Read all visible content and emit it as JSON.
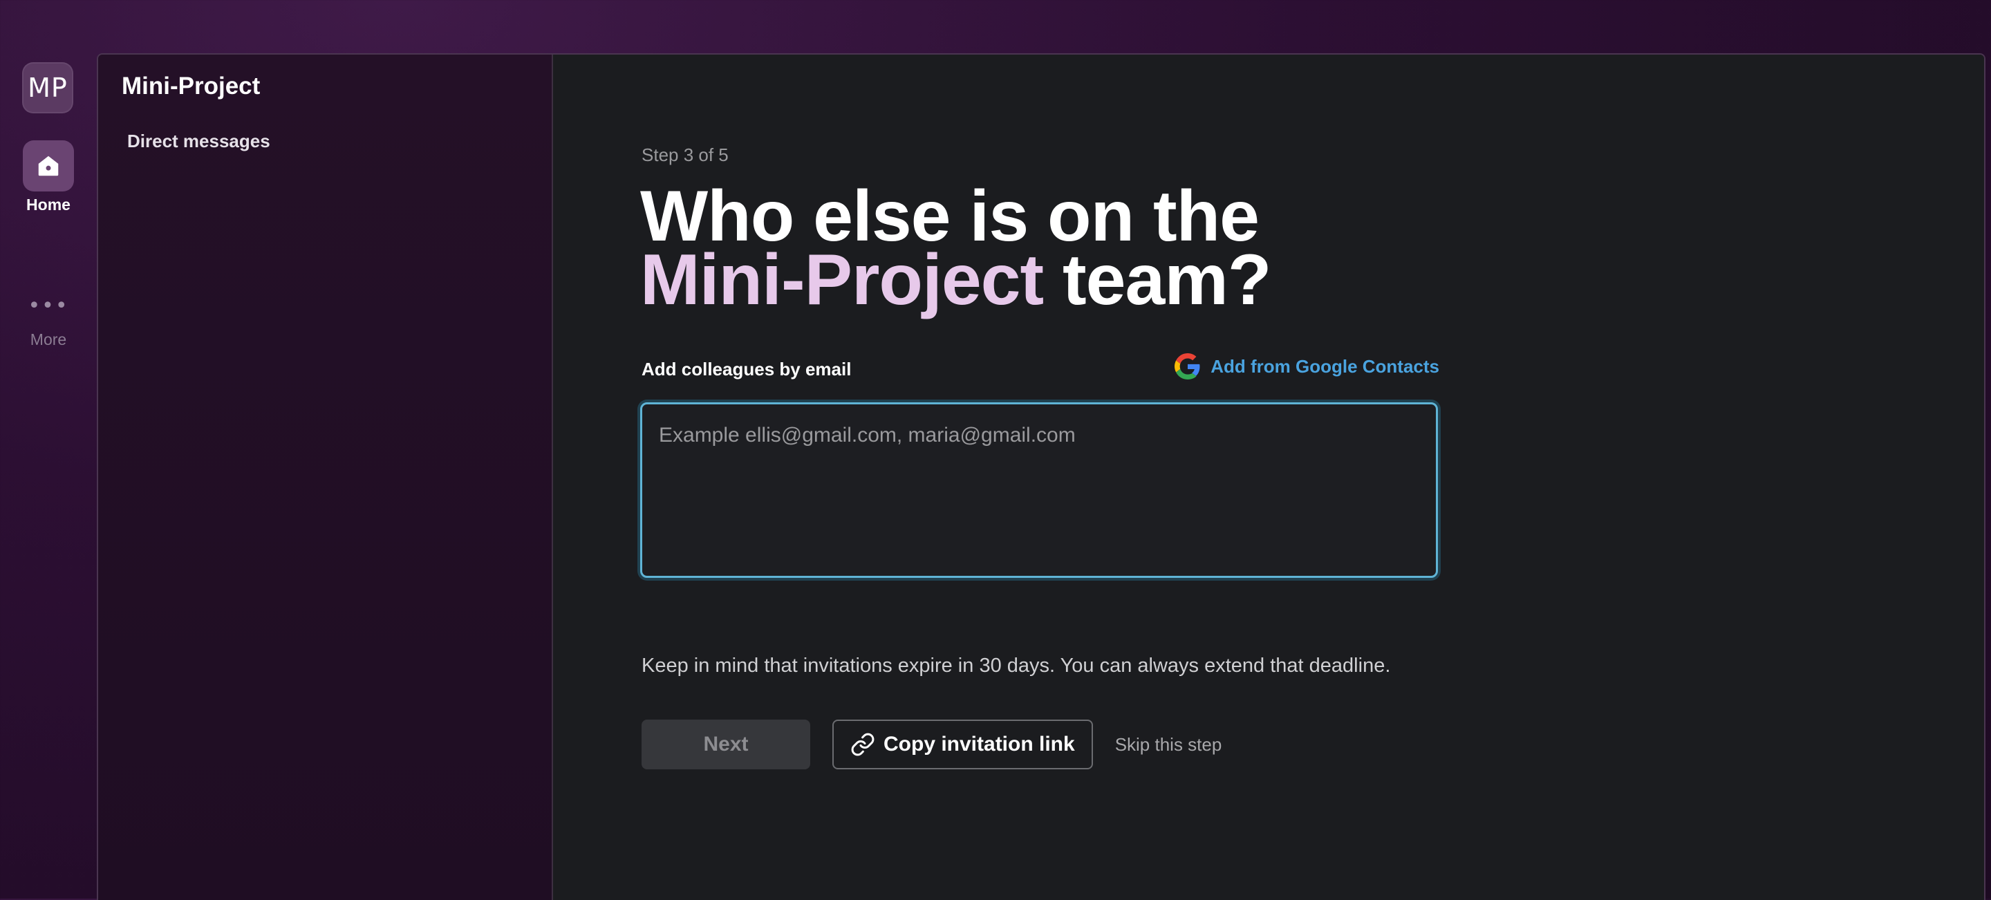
{
  "rail": {
    "workspace_initials": "MP",
    "home_label": "Home",
    "more_dots": "•••",
    "more_label": "More"
  },
  "sidebar": {
    "workspace_name": "Mini-Project",
    "items": [
      {
        "label": "Direct messages"
      }
    ]
  },
  "main": {
    "step": "Step 3 of 5",
    "headline": {
      "part1": "Who else is on the ",
      "workspace": "Mini-Project",
      "part2": " team?"
    },
    "field_label": "Add colleagues by email",
    "google_contacts_label": "Add from Google Contacts",
    "email_placeholder": "Example ellis@gmail.com, maria@gmail.com",
    "email_value": "",
    "hint": "Keep in mind that invitations expire in 30 days. You can always extend that deadline.",
    "next_label": "Next",
    "copy_link_label": "Copy invitation link",
    "skip_label": "Skip this step"
  },
  "icons": {
    "home": "home-icon",
    "more": "more-icon",
    "google": "google-icon",
    "link": "link-icon"
  },
  "colors": {
    "accent_text": "#e7c9ea",
    "link": "#4aa3df",
    "focus_ring": "#5fb4d6",
    "rail_bg": "#2c0f33",
    "content_bg": "#1b1c1f"
  }
}
